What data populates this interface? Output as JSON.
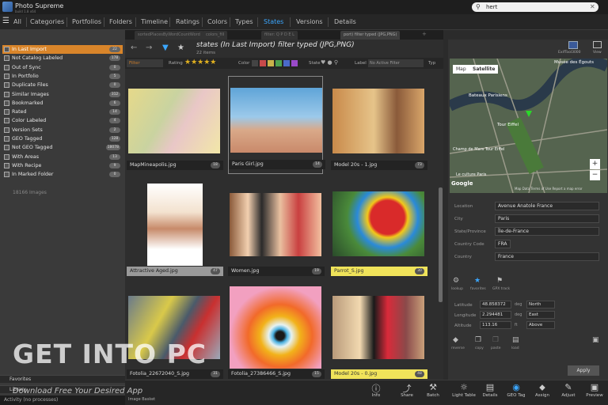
{
  "app": {
    "title": "Photo Supreme",
    "subtitle": "build 1.8 x64"
  },
  "search": {
    "value": "hert"
  },
  "nav": {
    "tabs": [
      "All",
      "Categories",
      "Portfolios",
      "Folders",
      "Timeline",
      "Ratings",
      "Colors",
      "Types",
      "States",
      "Versions",
      "Details"
    ],
    "active": "States"
  },
  "doc_tabs": [
    "sortedPlacesByWordCountWord",
    "colors_fill",
    "filter: Q P D E L",
    "port) filter typed (JPG,PNG)"
  ],
  "states": [
    {
      "label": "In Last Import",
      "count": "22",
      "selected": true
    },
    {
      "label": "Not Catalog Labeled",
      "count": "178"
    },
    {
      "label": "Out of Sync",
      "count": "0"
    },
    {
      "label": "In Portfolio",
      "count": "5"
    },
    {
      "label": "Duplicate Files",
      "count": "0"
    },
    {
      "label": "Similar Images",
      "count": "312"
    },
    {
      "label": "Bookmarked",
      "count": "6"
    },
    {
      "label": "Rated",
      "count": "14"
    },
    {
      "label": "Color Labeled",
      "count": "4"
    },
    {
      "label": "Version Sets",
      "count": "2"
    },
    {
      "label": "GEO Tagged",
      "count": "128"
    },
    {
      "label": "Not GEO Tagged",
      "count": "18078"
    },
    {
      "label": "With Areas",
      "count": "13"
    },
    {
      "label": "With Recipe",
      "count": "9"
    },
    {
      "label": "In Marked Folder",
      "count": "0"
    }
  ],
  "image_total": "18166 Images",
  "favorites": [
    "Favorites",
    "Library"
  ],
  "activity": "Activity (no processes)",
  "main": {
    "title": "states (In Last Import) filter typed (JPG,PNG)",
    "count": "22 items"
  },
  "filterbar": {
    "sort_label": "Rating",
    "dropdown": "Filter",
    "color_label": "Color",
    "state_label": "State",
    "label_label": "Label",
    "label_value": "No Active Filter",
    "type_label": "Typ"
  },
  "colors": {
    "red": "#c94a4a",
    "yellow": "#c9b24a",
    "green": "#4ea04e",
    "blue": "#4a6ac9",
    "purple": "#9a4ac9",
    "accent": "#3ba7ff",
    "selected_state": "#d9852a"
  },
  "thumbs": [
    {
      "name": "MapMineapolis.jpg",
      "badge": "18"
    },
    {
      "name": "Paris Girl.jpg",
      "badge": "14"
    },
    {
      "name": "Model 20s - 1.jpg",
      "badge": "73"
    },
    {
      "name": "Attractive Aged.jpg",
      "badge": "47"
    },
    {
      "name": "Women.jpg",
      "badge": "19"
    },
    {
      "name": "Parrot_S.jpg",
      "badge": "30"
    },
    {
      "name": "Fotolia_22672040_S.jpg",
      "badge": "31"
    },
    {
      "name": "Fotolia_27386466_S.jpg",
      "badge": "15"
    },
    {
      "name": "Model 20s - 0.jpg",
      "badge": "48"
    }
  ],
  "map": {
    "btn_map": "Map",
    "btn_satellite": "Satellite",
    "labels": [
      "Musée des Égouts",
      "Bateaux Parisiens",
      "Tour Eiffel",
      "Champ de Mars Tour Eiffel",
      "Le culture Paris",
      "Google"
    ],
    "attribution": "Map Data  Terms of Use  Report a map error"
  },
  "exif": {
    "label": "ExifTool3000",
    "view": "View"
  },
  "location": {
    "fields": [
      {
        "label": "Location",
        "value": "Avenue Anatole France"
      },
      {
        "label": "City",
        "value": "Paris"
      },
      {
        "label": "State/Province",
        "value": "Île-de-France"
      },
      {
        "label": "Country Code",
        "value": "FRA"
      },
      {
        "label": "Country",
        "value": "France"
      }
    ]
  },
  "geo_actions": [
    "lookup",
    "favorites",
    "GPX track"
  ],
  "geo": {
    "latitude": {
      "label": "Latitude",
      "value": "48.858372",
      "unit": "deg",
      "dir": "North"
    },
    "longitude": {
      "label": "Longitude",
      "value": "2.294481",
      "unit": "deg",
      "dir": "East"
    },
    "altitude": {
      "label": "Altitude",
      "value": "113.16",
      "unit": "ft",
      "dir": "Above"
    }
  },
  "geo_buttons": [
    "reverse",
    "copy",
    "paste",
    "load"
  ],
  "apply": "Apply",
  "bottom_toolbar": [
    "Info",
    "Share",
    "Batch",
    "Light Table",
    "Details",
    "GEO Tag",
    "Assign",
    "Adjust",
    "Preview"
  ],
  "image_basket": "Image Basket",
  "watermark": {
    "main": "GET INTO PC",
    "sub": "Download Free Your Desired App"
  }
}
